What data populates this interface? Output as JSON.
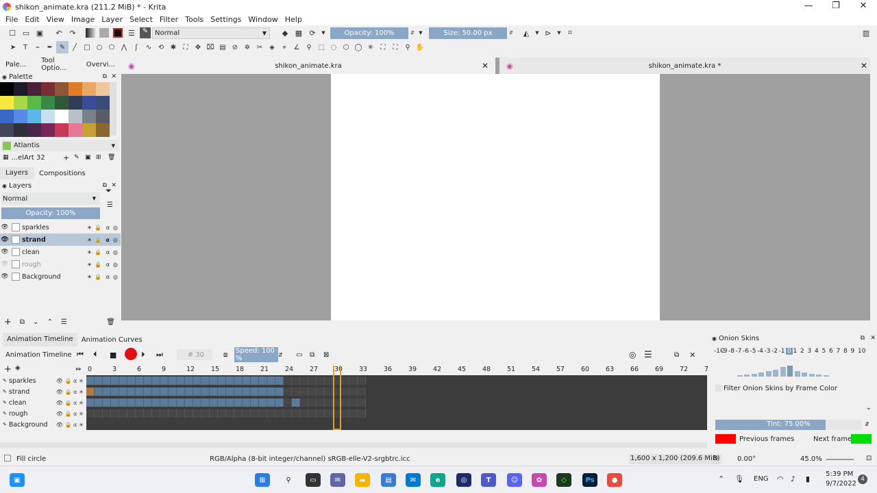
{
  "window": {
    "title": "shikon_animate.kra (211.2 MiB)  * - Krita",
    "minimize": "—",
    "maximize": "❐",
    "close": "✕"
  },
  "menu": [
    "File",
    "Edit",
    "View",
    "Image",
    "Layer",
    "Select",
    "Filter",
    "Tools",
    "Settings",
    "Window",
    "Help"
  ],
  "toolbar": {
    "blend_mode": "Normal",
    "opacity_label": "Opacity: 100%",
    "size_label": "Size: 50.00 px"
  },
  "docker_tabs": [
    "Pale...",
    "Tool Optio...",
    "Overvi..."
  ],
  "palette": {
    "title": "Palette",
    "colors": [
      "#000000",
      "#1e1a2c",
      "#4a2238",
      "#782e34",
      "#8e5638",
      "#e07b28",
      "#e8a868",
      "#f0c8a0",
      "#f8e840",
      "#a8d848",
      "#58b848",
      "#388848",
      "#305838",
      "#303c58",
      "#384c98",
      "#384c78",
      "#3868c8",
      "#5888e8",
      "#58b8e8",
      "#c8e0f0",
      "#ffffff",
      "#b8c0c8",
      "#78808c",
      "#585c68",
      "#404858",
      "#303038",
      "#482848",
      "#782858",
      "#c83858",
      "#e87898",
      "#c8a038",
      "#886830"
    ],
    "selected_name": "Atlantis",
    "selected_color": "#88c858",
    "set_name": "...elArt 32"
  },
  "layers_tabs": [
    "Layers",
    "Compositions"
  ],
  "layers": {
    "title": "Layers",
    "blend": "Normal",
    "opacity": "Opacity:  100%",
    "items": [
      {
        "name": "sparkles",
        "selected": false,
        "dim": false
      },
      {
        "name": "strand",
        "selected": true,
        "dim": false
      },
      {
        "name": "clean",
        "selected": false,
        "dim": false
      },
      {
        "name": "rough",
        "selected": false,
        "dim": true
      },
      {
        "name": "Background",
        "selected": false,
        "dim": false
      }
    ]
  },
  "doc_tabs": [
    "shikon_animate.kra",
    "shikon_animate.kra *"
  ],
  "timeline": {
    "tabs": [
      "Animation Timeline",
      "Animation Curves"
    ],
    "label": "Animation Timeline",
    "frame": "30",
    "speed": "Speed: 100 %",
    "ruler": [
      "0",
      "3",
      "6",
      "9",
      "12",
      "15",
      "18",
      "21",
      "24",
      "27",
      "30",
      "33",
      "36",
      "39",
      "42",
      "45",
      "48",
      "51",
      "54",
      "57",
      "60",
      "63",
      "66",
      "69",
      "72",
      "7"
    ],
    "tracks": [
      "sparkles",
      "strand",
      "clean",
      "rough",
      "Background"
    ]
  },
  "onion": {
    "title": "Onion Skins",
    "numbers": [
      "-1C",
      "-9",
      "-8",
      "-7",
      "-6",
      "-5",
      "-4",
      "-3",
      "-2",
      "-1",
      "0",
      "1",
      "2",
      "3",
      "4",
      "5",
      "6",
      "7",
      "8",
      "9",
      "10"
    ],
    "filter_label": "Filter Onion Skins by Frame Color",
    "tint": "Tint: 75.00%",
    "tint_level": 0.75,
    "prev_label": "Previous frames",
    "next_label": "Next frames",
    "prev_color": "#ff0000",
    "next_color": "#00dd00"
  },
  "status": {
    "tool": "Fill circle",
    "colorspace": "RGB/Alpha (8-bit integer/channel)  sRGB-elle-V2-srgbtrc.icc",
    "dimensions": "1,600 x 1,200 (209.6 MiB)",
    "rotation": "0.00°",
    "zoom": "45.0%"
  },
  "taskbar": {
    "lang": "ENG",
    "time": "5:39 PM",
    "date": "9/7/2022",
    "badge": "4"
  }
}
